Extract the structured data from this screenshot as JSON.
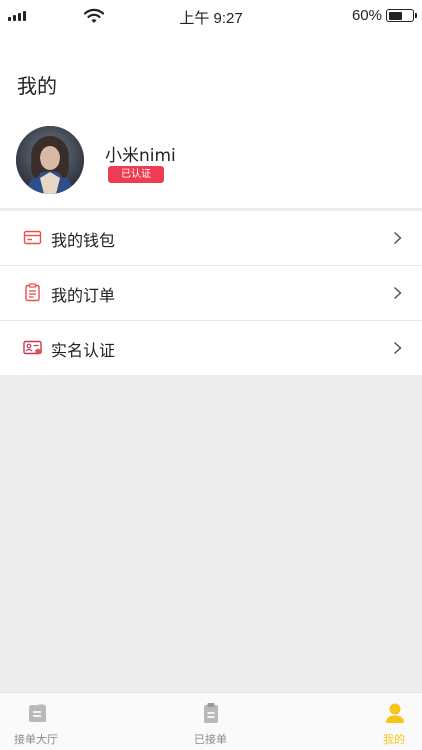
{
  "status_bar": {
    "time": "上午 9:27",
    "battery_percent": "60%",
    "battery_level": 0.6
  },
  "page": {
    "title": "我的"
  },
  "profile": {
    "username": "小米nimi",
    "verified_badge": "已认证"
  },
  "menu": [
    {
      "label": "我的钱包",
      "icon": "wallet-icon"
    },
    {
      "label": "我的订单",
      "icon": "order-icon"
    },
    {
      "label": "实名认证",
      "icon": "id-card-icon"
    }
  ],
  "tabbar": {
    "tabs": [
      {
        "label": "接单大厅",
        "icon": "hall-icon",
        "active": false
      },
      {
        "label": "已接单",
        "icon": "clipboard-icon",
        "active": false
      },
      {
        "label": "我的",
        "icon": "user-icon",
        "active": true
      }
    ]
  },
  "colors": {
    "accent": "#f5c518",
    "badge": "#ee3d52",
    "menu_icon": "#e8504c",
    "inactive_tab": "#b9b9b9"
  }
}
